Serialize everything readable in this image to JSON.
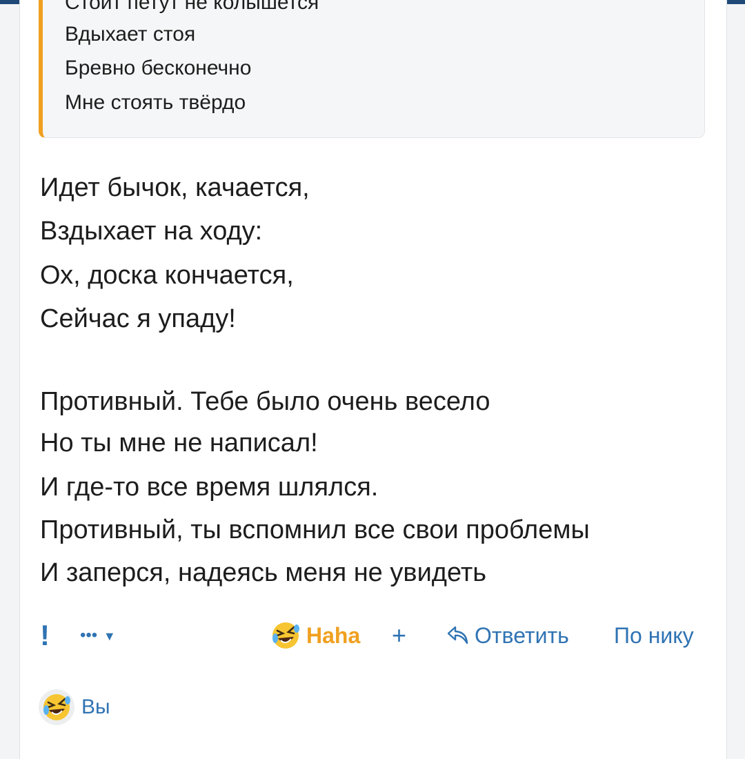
{
  "quote": {
    "lines": [
      "Стоит петут не колышется",
      "Вдыхает стоя",
      "Бревно бесконечно",
      "Мне стоять твёрдо"
    ],
    "accent_color": "#f0a020"
  },
  "post": {
    "lines": [
      "Идет бычок, качается,",
      "Вздыхает на ходу:",
      "Ох, доска кончается,",
      "Сейчас я упаду!",
      "Противный. Тебе было очень весело",
      "Но ты мне не написал!",
      "И где-то все время шлялся.",
      "Противный, ты вспомнил все свои проблемы",
      "И заперся, надеясь меня не увидеть"
    ]
  },
  "actions": {
    "report_label": "!",
    "more_label": "•••",
    "reaction_label": "Haha",
    "reaction_icon": "rofl-emoji-icon",
    "add_reaction_label": "+",
    "reply_label": "Ответить",
    "by_nick_label": "По нику",
    "link_color": "#2f73b3"
  },
  "reactors": {
    "label": "Вы",
    "icon": "rofl-emoji-icon"
  }
}
